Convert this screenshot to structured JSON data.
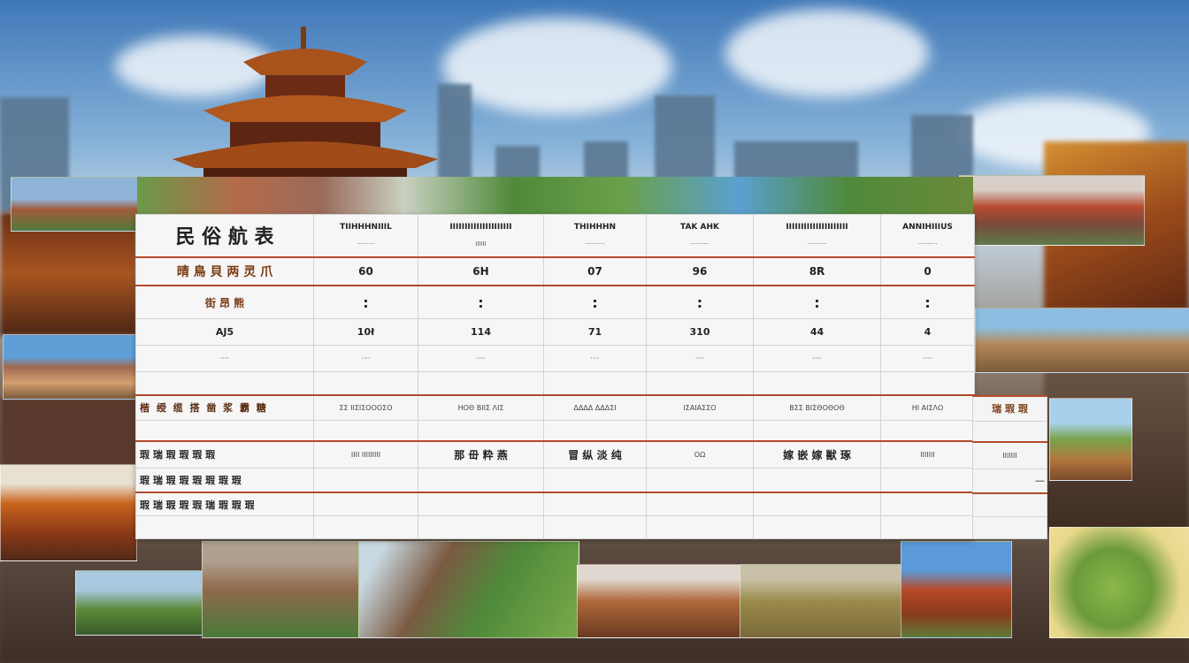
{
  "table": {
    "title": "民 俗 航 表",
    "headers": [
      {
        "top": "TIIHHHNIIIL",
        "sub": "·········"
      },
      {
        "top": "IIIIIIIIIIIIIIIIIIIII",
        "sub": "IIIIII"
      },
      {
        "top": "THIHHHN",
        "sub": "··········"
      },
      {
        "top": "TAK AHK",
        "sub": "··········"
      },
      {
        "top": "IIIIIIIIIIIIIIIIIIIII",
        "sub": "··········"
      },
      {
        "top": "ANNIHIIIUS",
        "sub": "··········"
      }
    ],
    "row1": {
      "label": "晴 鳥 貝 两 灵 爪",
      "values": [
        "60",
        "6H",
        "07",
        "96",
        "8R",
        "0"
      ]
    },
    "row2": {
      "label": "街 昂 熊",
      "values": [
        ":",
        ":",
        ":",
        ":",
        ":",
        ":"
      ]
    },
    "row3": {
      "label": "AJ5",
      "values": [
        "10ł",
        "114",
        "71",
        "310",
        "44",
        "4"
      ]
    },
    "row4": {
      "label": "····",
      "values": [
        "····",
        "····",
        "····",
        "····",
        "····",
        "····"
      ]
    },
    "row5": {
      "label": "楷 绶 缆 搭 凿 浆 霸 糖",
      "values": [
        "ΣΣ ΙΙΣΙΣΟΟΟΣΟ",
        "ΗΟΘ ΒΙΙΣ ΛΙΣ",
        "ΔΔΔΔ ΔΔΔΣΙ",
        "ΙΣΑΙΑΣΣΟ",
        "ΒΣΣ ΒΙΣΘΟΘΟΘ",
        "ΗΙ ΑΙΣΛΟ"
      ],
      "extra": "瑞 瑕 瑕"
    },
    "row6": {
      "label": "瑕 瑞 瑕 瑕 瑕 瑕",
      "values": [
        "ΙΙΙΙ ΙΙΙΙΙΙΙΙΙ",
        "那 毌 粋 燕",
        "冒 纵 淡 纯",
        "ΟΩ",
        "嫁 嵌 嫁 獣 琢",
        "ΙΙΙΙΙΙΙ"
      ],
      "extra": "ΙΙΙΙΙΙΙ"
    },
    "row7": {
      "label": "瑕 瑞 瑕 瑕 瑕 瑕 瑕 瑕",
      "extra": "—"
    },
    "row8": {
      "label": "瑕 瑞 瑕 瑕 瑕 瑞 瑕 瑕 瑕"
    }
  }
}
